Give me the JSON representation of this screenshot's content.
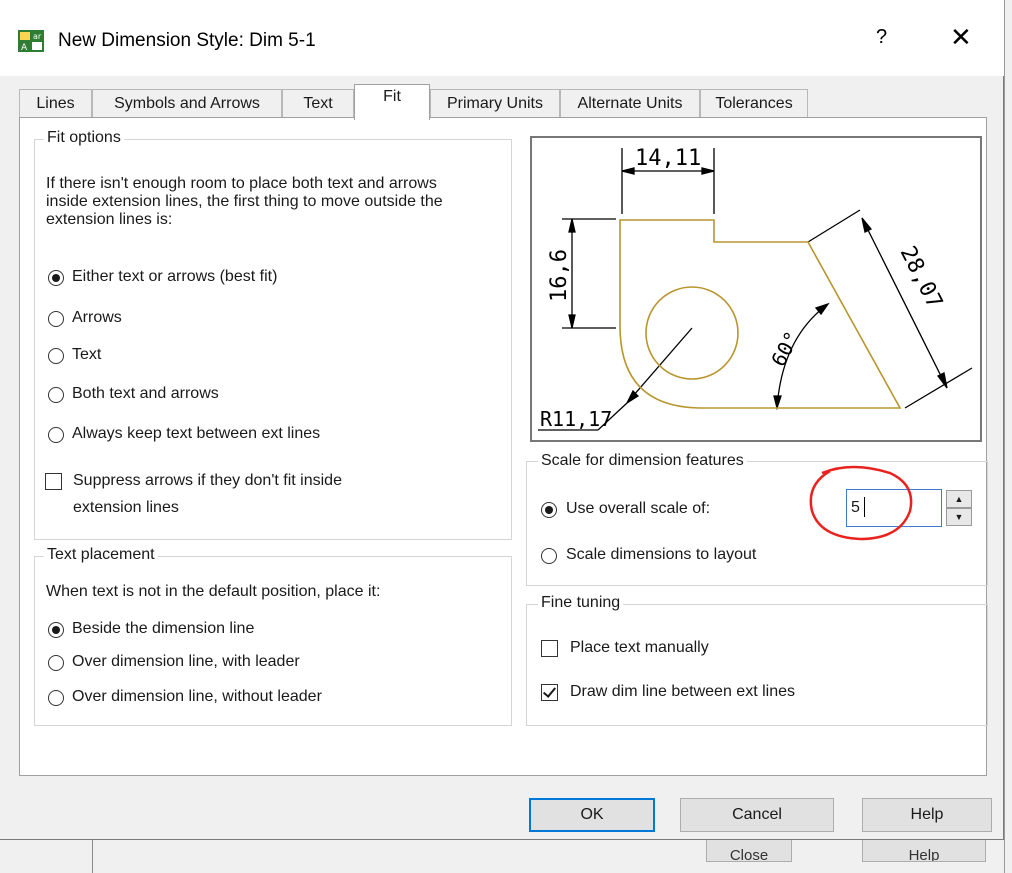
{
  "background_window": {
    "buttons": [
      "Close",
      "Help"
    ]
  },
  "dialog": {
    "title": "New Dimension Style: Dim 5-1",
    "app_icon": "autocad-dimstyle-icon",
    "help_glyph": "?",
    "close_glyph": "✕"
  },
  "tabs": [
    {
      "label": "Lines"
    },
    {
      "label": "Symbols and Arrows"
    },
    {
      "label": "Text"
    },
    {
      "label": "Fit",
      "active": true
    },
    {
      "label": "Primary Units"
    },
    {
      "label": "Alternate Units"
    },
    {
      "label": "Tolerances"
    }
  ],
  "fit_options": {
    "legend": "Fit options",
    "description": "If there isn't enough room to place both text and arrows inside extension lines, the first thing to move outside the extension lines is:",
    "options": [
      {
        "label": "Either text or arrows (best fit)",
        "checked": true
      },
      {
        "label": "Arrows",
        "checked": false
      },
      {
        "label": "Text",
        "checked": false
      },
      {
        "label": "Both text and arrows",
        "checked": false
      },
      {
        "label": "Always keep text between ext lines",
        "checked": false
      }
    ],
    "suppress": {
      "label_line1": "Suppress arrows if they don't fit inside",
      "label_line2": "extension lines",
      "checked": false
    }
  },
  "text_placement": {
    "legend": "Text placement",
    "description": "When text is not in the default position, place it:",
    "options": [
      {
        "label": "Beside the dimension line",
        "checked": true
      },
      {
        "label": "Over dimension line, with leader",
        "checked": false
      },
      {
        "label": "Over dimension line, without leader",
        "checked": false
      }
    ]
  },
  "preview": {
    "dim_horizontal": "14,11",
    "dim_vertical": "16,6",
    "dim_aligned": "28,07",
    "dim_angle": "60°",
    "dim_radius": "R11,17",
    "part_color": "#b8962e"
  },
  "scale": {
    "legend": "Scale for dimension features",
    "overall_label": "Use overall scale of:",
    "overall_checked": true,
    "overall_value": "5",
    "layout_label": "Scale dimensions to layout",
    "layout_checked": false,
    "annotation_color": "#e8231f"
  },
  "fine_tuning": {
    "legend": "Fine tuning",
    "place_manually": {
      "label": "Place text manually",
      "checked": false
    },
    "draw_dim_line": {
      "label": "Draw dim line between ext lines",
      "checked": true
    }
  },
  "buttons": {
    "ok": "OK",
    "cancel": "Cancel",
    "help": "Help"
  }
}
